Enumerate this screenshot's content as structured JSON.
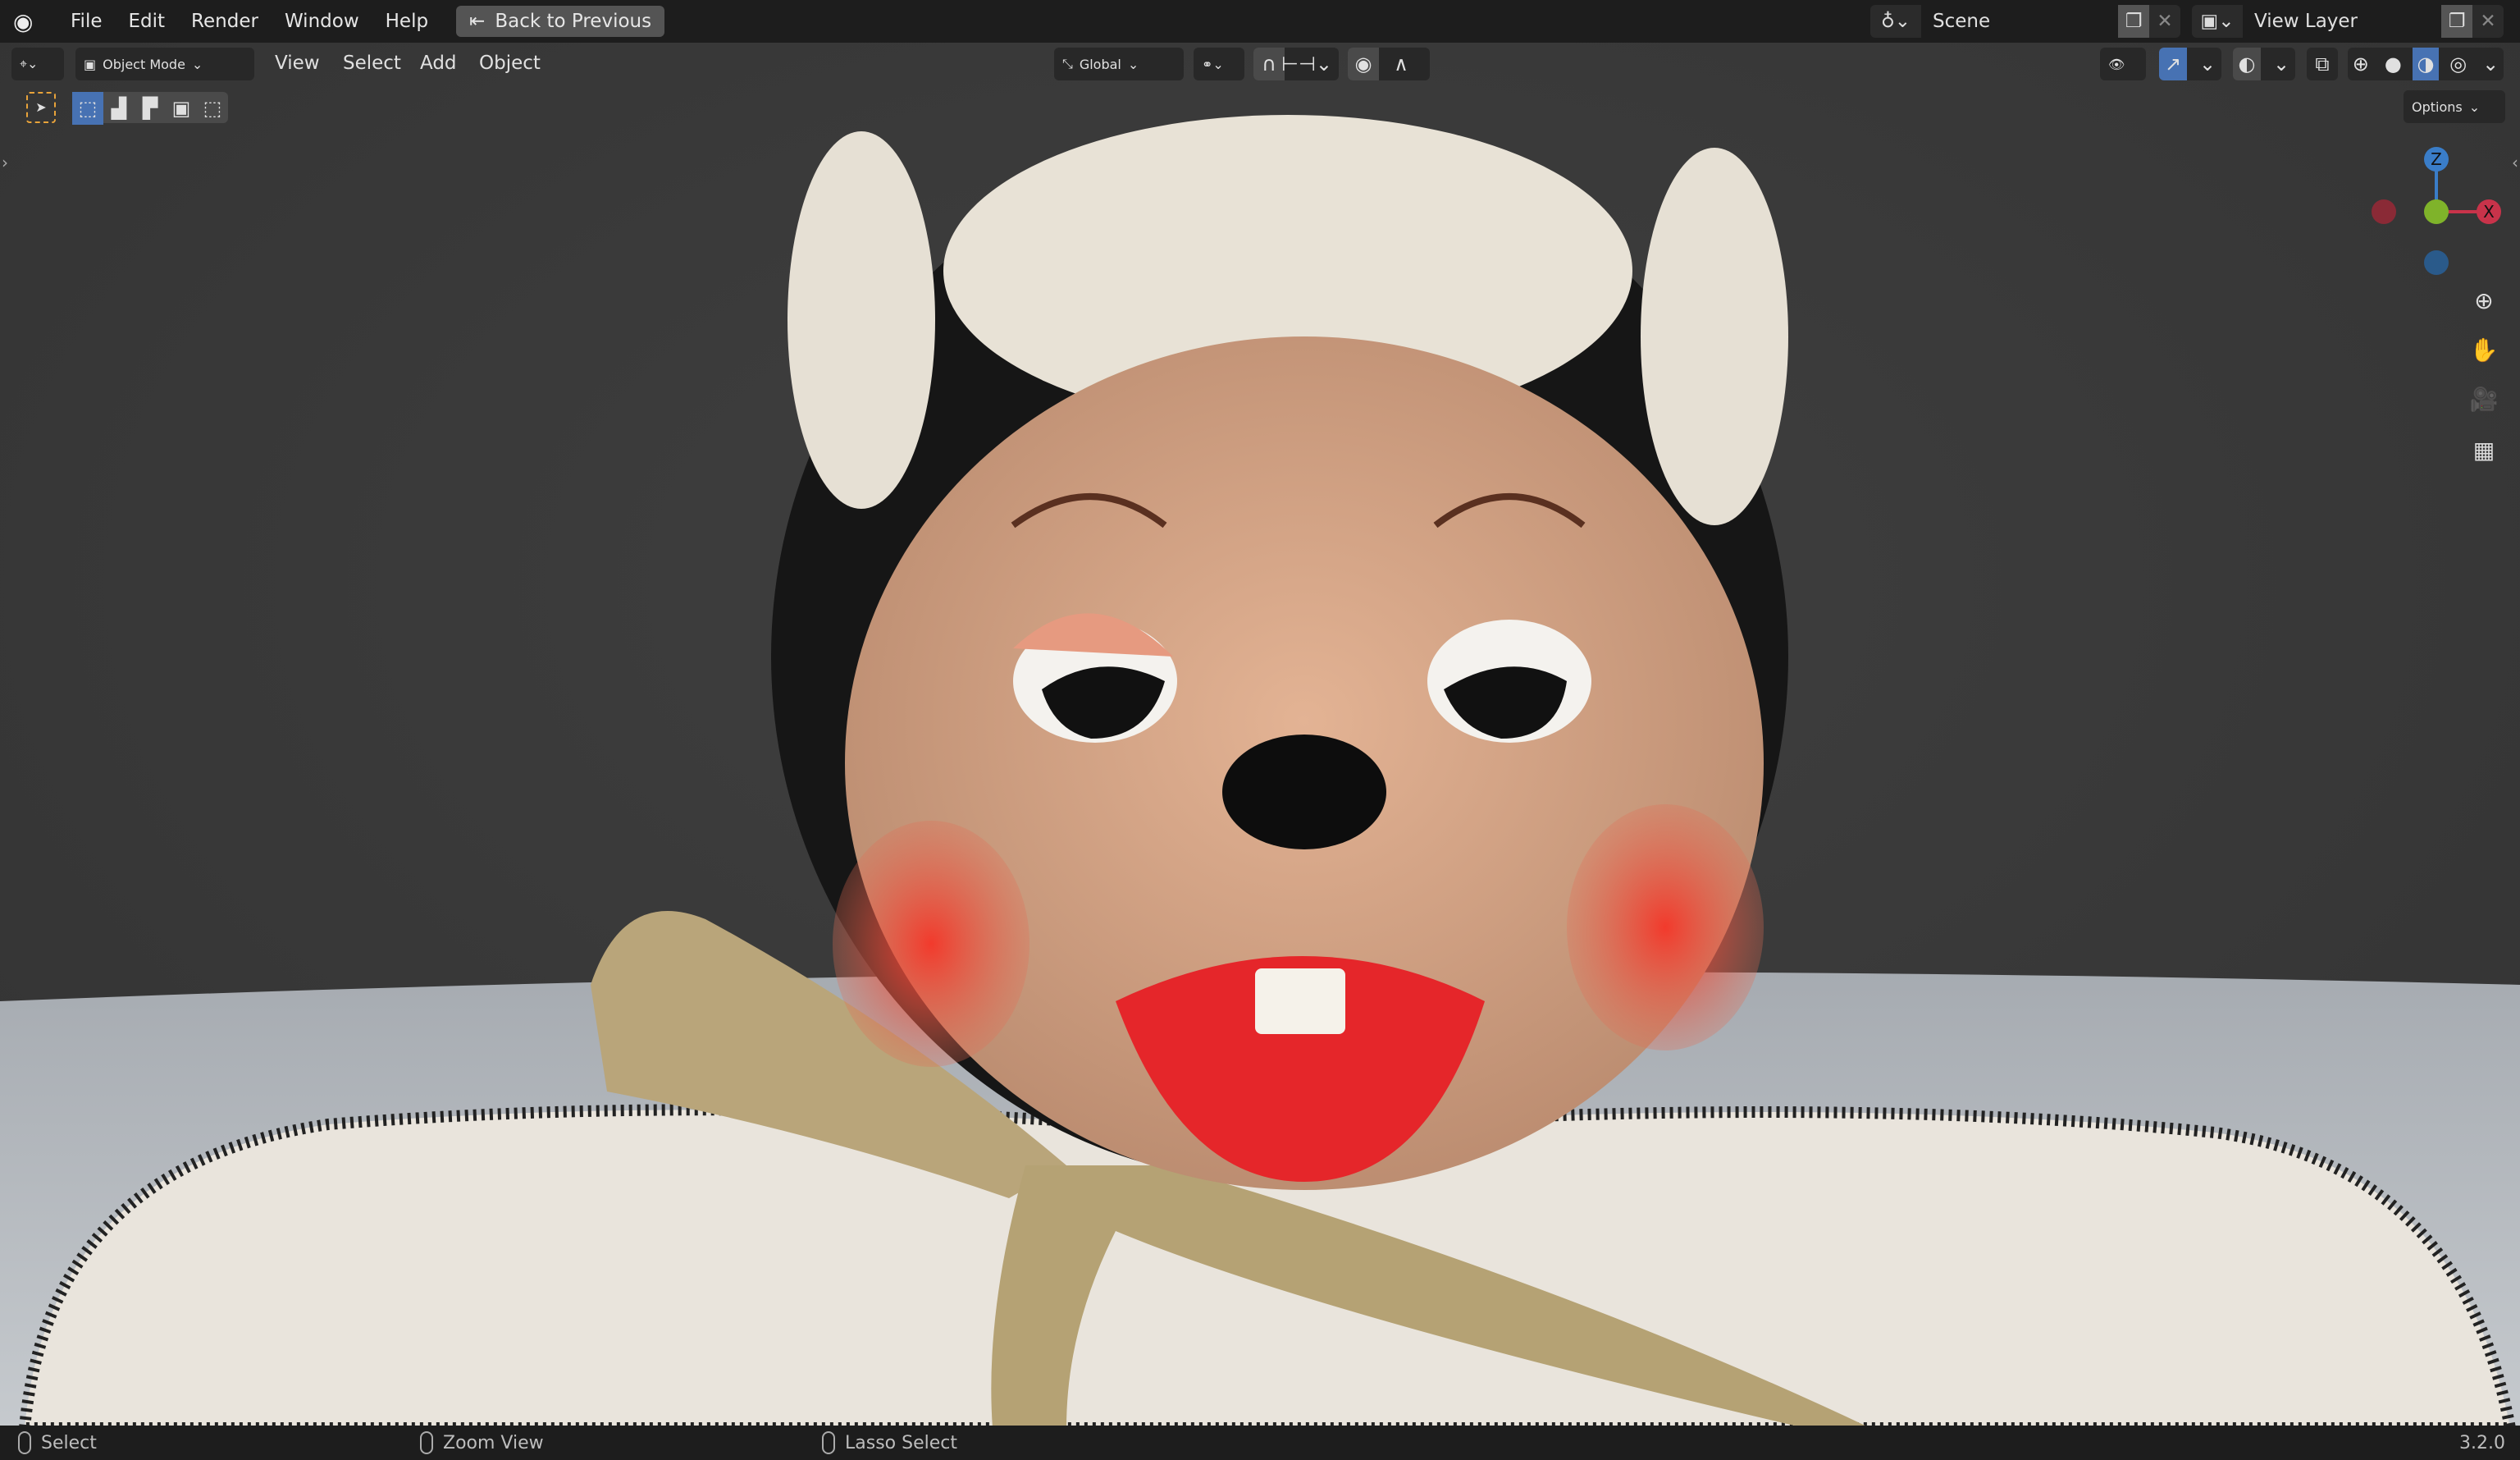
{
  "topbar": {
    "menus": [
      "File",
      "Edit",
      "Render",
      "Window",
      "Help"
    ],
    "back_button": "Back to Previous",
    "scene": {
      "name": "Scene",
      "icon": "scene-icon"
    },
    "view_layer": {
      "name": "View Layer",
      "icon": "render-layers-icon"
    }
  },
  "header": {
    "editor_type_icon": "3d-viewport-icon",
    "mode": "Object Mode",
    "menus": [
      "View",
      "Select",
      "Add",
      "Object"
    ],
    "transform_orientation": "Global",
    "options_label": "Options"
  },
  "gizmo": {
    "z": "Z",
    "x": "X"
  },
  "statusbar": {
    "items": [
      "Select",
      "Zoom View",
      "Lasso Select"
    ],
    "version": "3.2.0"
  },
  "colors": {
    "accent": "#4772b3",
    "topbar": "#1d1d1d",
    "viewport": "#3a3a3a",
    "x_axis": "#c8334a",
    "y_axis": "#7fb32a",
    "z_axis": "#3a7dc8"
  }
}
